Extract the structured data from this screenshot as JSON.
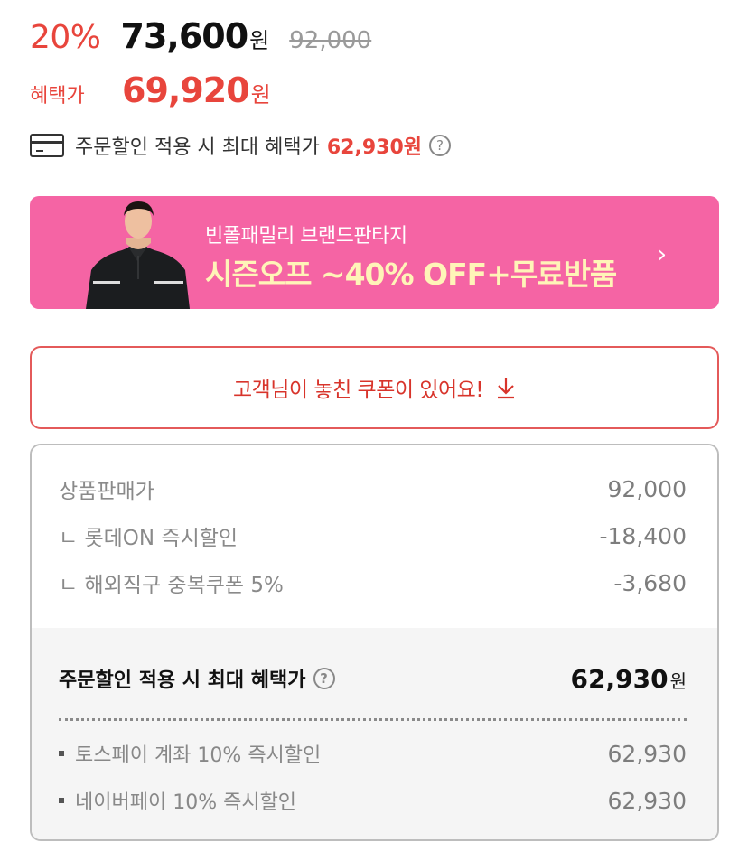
{
  "price": {
    "discount_rate": "20%",
    "sale_price": "73,600",
    "unit": "원",
    "original_price": "92,000"
  },
  "benefit": {
    "label": "혜택가",
    "price": "69,920",
    "unit": "원"
  },
  "order_benefit": {
    "text": "주문할인 적용 시 최대 혜택가",
    "price": "62,930원",
    "help": "?"
  },
  "banner": {
    "subtitle": "빈폴패밀리 브랜드판타지",
    "title": "시즌오프 ~40% OFF+무료반품",
    "chevron": "›"
  },
  "coupon": {
    "label": "고객님이 놓친 쿠폰이 있어요!"
  },
  "breakdown": {
    "rows": [
      {
        "label": "상품판매가",
        "value": "92,000"
      },
      {
        "label": "ㄴ 롯데ON 즉시할인",
        "value": "-18,400"
      },
      {
        "label": "ㄴ 해외직구 중복쿠폰 5%",
        "value": "-3,680"
      }
    ],
    "total": {
      "label": "주문할인 적용 시 최대 혜택가",
      "help": "?",
      "value": "62,930",
      "unit": "원"
    },
    "payments": [
      {
        "label": "토스페이 계좌 10% 즉시할인",
        "value": "62,930"
      },
      {
        "label": "네이버페이 10% 즉시할인",
        "value": "62,930"
      }
    ]
  },
  "icons": {
    "card": "credit-card-icon",
    "help": "help-circle-icon",
    "download": "download-arrow-icon",
    "chevron": "chevron-right-icon"
  },
  "colors": {
    "accent_red": "#e8453c",
    "banner_pink": "#f564a4",
    "banner_title": "#fff4b8",
    "coupon_border": "#e45a5a"
  }
}
